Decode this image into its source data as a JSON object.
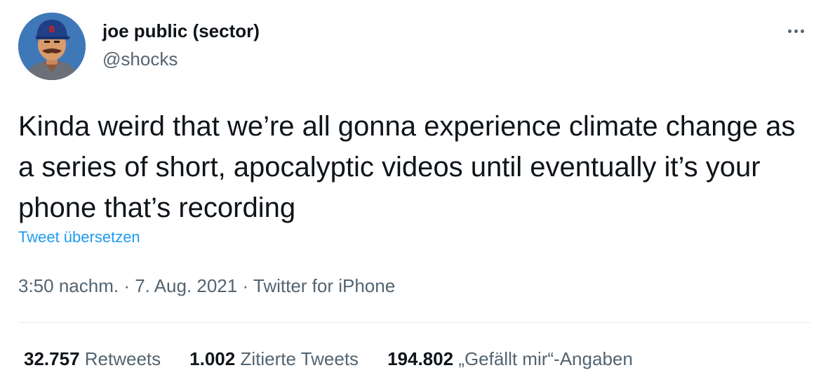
{
  "user": {
    "display_name": "joe public (sector)",
    "handle": "@shocks"
  },
  "tweet": {
    "text": "Kinda weird that we’re all gonna experience climate change as a series of short, apocalyptic videos until eventually it’s your phone that’s recording",
    "translate_label": "Tweet übersetzen"
  },
  "meta": {
    "time": "3:50 nachm.",
    "separator": " · ",
    "date": "7. Aug. 2021",
    "source": "Twitter for iPhone"
  },
  "stats": {
    "retweets_count": "32.757",
    "retweets_label": "Retweets",
    "quotes_count": "1.002",
    "quotes_label": "Zitierte Tweets",
    "likes_count": "194.802",
    "likes_label": "„Gefällt mir“-Angaben"
  },
  "colors": {
    "text": "#0f1419",
    "secondary": "#536471",
    "link": "#1d9bf0",
    "divider": "#e7eaed"
  },
  "icons": {
    "more": "more-horizontal-icon"
  }
}
